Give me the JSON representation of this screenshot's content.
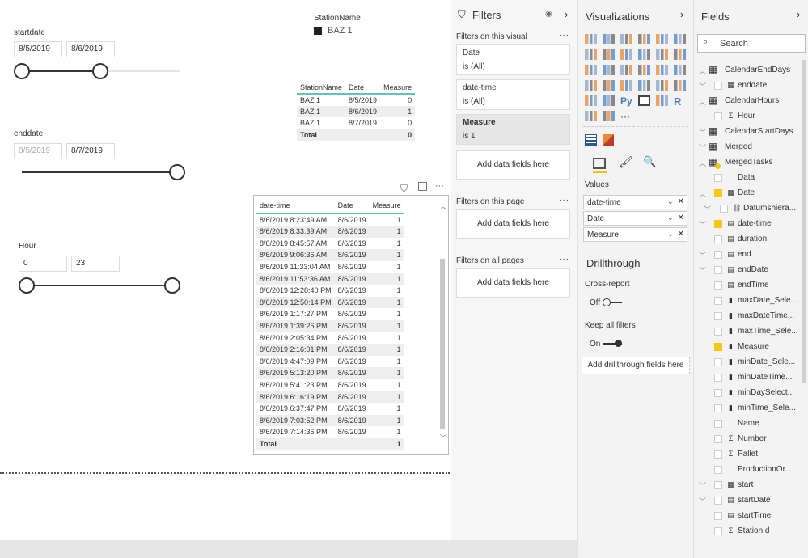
{
  "canvas": {
    "station_legend": {
      "title": "StationName",
      "item": "BAZ 1",
      "color": "#222222"
    },
    "startdate": {
      "label": "startdate",
      "from": "8/5/2019",
      "to": "8/6/2019"
    },
    "enddate": {
      "label": "enddate",
      "from": "8/5/2019",
      "to": "8/7/2019"
    },
    "hour": {
      "label": "Hour",
      "from": "0",
      "to": "23"
    },
    "small_table": {
      "headers": [
        "StationName",
        "Date",
        "Measure"
      ],
      "rows": [
        [
          "BAZ 1",
          "8/5/2019",
          "0"
        ],
        [
          "BAZ 1",
          "8/6/2019",
          "1"
        ],
        [
          "BAZ 1",
          "8/7/2019",
          "0"
        ]
      ],
      "total": [
        "Total",
        "",
        "0"
      ]
    },
    "big_table": {
      "headers": [
        "date-time",
        "Date",
        "Measure"
      ],
      "rows": [
        [
          "8/6/2019 8:23:49 AM",
          "8/6/2019",
          "1"
        ],
        [
          "8/6/2019 8:33:39 AM",
          "8/6/2019",
          "1"
        ],
        [
          "8/6/2019 8:45:57 AM",
          "8/6/2019",
          "1"
        ],
        [
          "8/6/2019 9:06:36 AM",
          "8/6/2019",
          "1"
        ],
        [
          "8/6/2019 11:33:04 AM",
          "8/6/2019",
          "1"
        ],
        [
          "8/6/2019 11:53:36 AM",
          "8/6/2019",
          "1"
        ],
        [
          "8/6/2019 12:28:40 PM",
          "8/6/2019",
          "1"
        ],
        [
          "8/6/2019 12:50:14 PM",
          "8/6/2019",
          "1"
        ],
        [
          "8/6/2019 1:17:27 PM",
          "8/6/2019",
          "1"
        ],
        [
          "8/6/2019 1:39:26 PM",
          "8/6/2019",
          "1"
        ],
        [
          "8/6/2019 2:05:34 PM",
          "8/6/2019",
          "1"
        ],
        [
          "8/6/2019 2:16:01 PM",
          "8/6/2019",
          "1"
        ],
        [
          "8/6/2019 4:47:09 PM",
          "8/6/2019",
          "1"
        ],
        [
          "8/6/2019 5:13:20 PM",
          "8/6/2019",
          "1"
        ],
        [
          "8/6/2019 5:41:23 PM",
          "8/6/2019",
          "1"
        ],
        [
          "8/6/2019 6:16:19 PM",
          "8/6/2019",
          "1"
        ],
        [
          "8/6/2019 6:37:47 PM",
          "8/6/2019",
          "1"
        ],
        [
          "8/6/2019 7:03:52 PM",
          "8/6/2019",
          "1"
        ],
        [
          "8/6/2019 7:14:36 PM",
          "8/6/2019",
          "1"
        ]
      ],
      "total": [
        "Total",
        "",
        "1"
      ]
    },
    "visual_menu": "···"
  },
  "filters": {
    "title": "Filters",
    "on_visual": "Filters on this visual",
    "more": "···",
    "cards": [
      {
        "name": "Date",
        "value": "is (All)"
      },
      {
        "name": "date-time",
        "value": "is (All)"
      },
      {
        "name": "Measure",
        "value": "is 1"
      }
    ],
    "add": "Add data fields here",
    "on_page": "Filters on this page",
    "on_all": "Filters on all pages"
  },
  "viz": {
    "title": "Visualizations",
    "more": "···",
    "values_label": "Values",
    "wells": [
      "date-time",
      "Date",
      "Measure"
    ],
    "drillthrough": "Drillthrough",
    "cross_report": "Cross-report",
    "cross_state": "Off",
    "keep_all": "Keep all filters",
    "keep_state": "On",
    "add_drill": "Add drillthrough fields here",
    "py": "Py",
    "r": "R"
  },
  "fields": {
    "title": "Fields",
    "search_placeholder": "Search",
    "items": [
      {
        "name": "CalendarEndDays",
        "chev": "up",
        "table": true
      },
      {
        "name": "enddate",
        "chev": "down",
        "icon": "calendar",
        "level": 1
      },
      {
        "name": "CalendarHours",
        "chev": "up",
        "table": true
      },
      {
        "name": "Hour",
        "icon": "sigma",
        "level": 1
      },
      {
        "name": "CalendarStartDays",
        "chev": "down",
        "table": true
      },
      {
        "name": "Merged",
        "chev": "down",
        "table": true
      },
      {
        "name": "MergedTasks",
        "chev": "up",
        "table": true,
        "checked": true
      },
      {
        "name": "Data",
        "level": 1
      },
      {
        "name": "Date",
        "chev": "up",
        "icon": "calendar",
        "level": 1,
        "checked": true
      },
      {
        "name": "Datumshiera...",
        "chev": "down",
        "icon": "hierarchy",
        "level": 2
      },
      {
        "name": "date-time",
        "chev": "down",
        "icon": "datetime",
        "level": 1,
        "checked": true
      },
      {
        "name": "duration",
        "icon": "datetime",
        "level": 1
      },
      {
        "name": "end",
        "chev": "down",
        "icon": "datetime",
        "level": 1
      },
      {
        "name": "endDate",
        "chev": "down",
        "icon": "datetime",
        "level": 1
      },
      {
        "name": "endTime",
        "icon": "datetime",
        "level": 1
      },
      {
        "name": "maxDate_Sele...",
        "icon": "calculator",
        "level": 1
      },
      {
        "name": "maxDateTime...",
        "icon": "calculator",
        "level": 1
      },
      {
        "name": "maxTime_Sele...",
        "icon": "calculator",
        "level": 1
      },
      {
        "name": "Measure",
        "icon": "calculator",
        "level": 1,
        "checked": true
      },
      {
        "name": "minDate_Sele...",
        "icon": "calculator",
        "level": 1
      },
      {
        "name": "minDateTime...",
        "icon": "calculator",
        "level": 1
      },
      {
        "name": "minDaySelect...",
        "icon": "calculator",
        "level": 1
      },
      {
        "name": "minTime_Sele...",
        "icon": "calculator",
        "level": 1
      },
      {
        "name": "Name",
        "level": 1
      },
      {
        "name": "Number",
        "icon": "sigma",
        "level": 1
      },
      {
        "name": "Pallet",
        "icon": "sigma",
        "level": 1
      },
      {
        "name": "ProductionOr...",
        "level": 1
      },
      {
        "name": "start",
        "chev": "down",
        "icon": "calendar",
        "level": 1
      },
      {
        "name": "startDate",
        "chev": "down",
        "icon": "datetime",
        "level": 1
      },
      {
        "name": "startTime",
        "icon": "datetime",
        "level": 1
      },
      {
        "name": "StationId",
        "icon": "sigma",
        "level": 1
      }
    ]
  }
}
